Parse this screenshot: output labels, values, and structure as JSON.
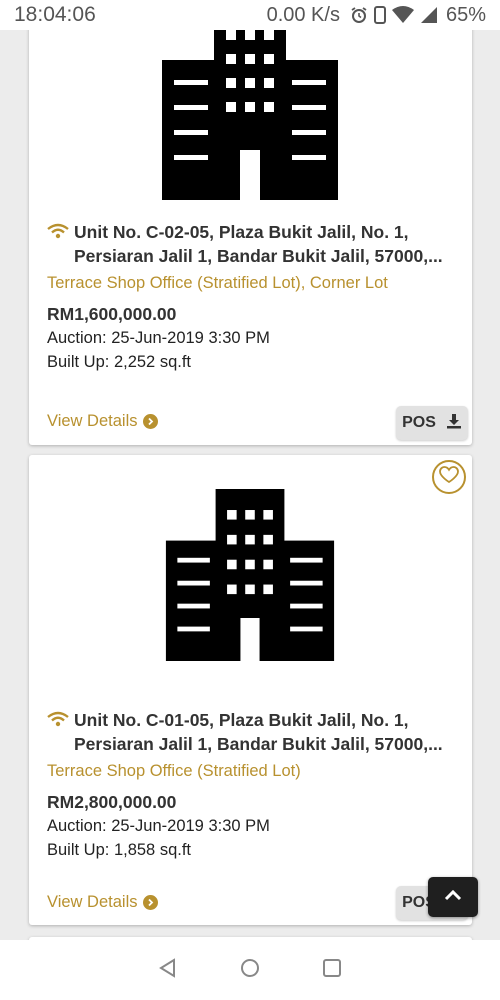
{
  "status_bar": {
    "time": "18:04:06",
    "net_speed": "0.00 K/s",
    "battery": "65%",
    "icons": [
      "alarm-icon",
      "phone-icon",
      "wifi-signal-icon",
      "cell-signal-icon"
    ]
  },
  "listings": [
    {
      "title": "Unit No. C-02-05, Plaza Bukit Jalil, No. 1, Persiaran Jalil 1, Bandar Bukit Jalil, 57000,...",
      "type": "Terrace Shop Office (Stratified Lot), Corner Lot",
      "price": "RM1,600,000.00",
      "auction": "Auction: 25-Jun-2019 3:30 PM",
      "built_up": "Built Up: 2,252 sq.ft",
      "view_details": "View Details",
      "pos_label": "POS"
    },
    {
      "title": "Unit No. C-01-05, Plaza Bukit Jalil, No. 1, Persiaran Jalil 1, Bandar Bukit Jalil, 57000,...",
      "type": "Terrace Shop Office (Stratified Lot)",
      "price": "RM2,800,000.00",
      "auction": "Auction: 25-Jun-2019 3:30 PM",
      "built_up": "Built Up: 1,858 sq.ft",
      "view_details": "View Details",
      "pos_label": "POS"
    }
  ],
  "colors": {
    "accent": "#b8912f",
    "text": "#333333",
    "background": "#ececec"
  }
}
